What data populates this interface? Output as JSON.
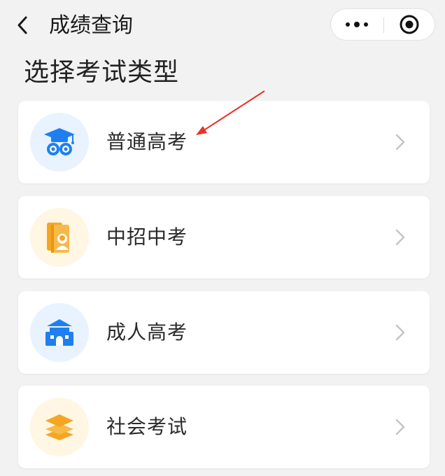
{
  "nav": {
    "back_icon": "chevron-left-icon",
    "title": "成绩查询",
    "more_icon": "ellipsis-icon",
    "close_icon": "target-circle-icon"
  },
  "heading": "选择考试类型",
  "cards": [
    {
      "label": "普通高考",
      "icon": "graduation-owl-icon",
      "icon_bg": "#e8f3ff",
      "icon_color": "#1f7ff0"
    },
    {
      "label": "中招中考",
      "icon": "book-student-icon",
      "icon_bg": "#fff6e3",
      "icon_color": "#f4a623"
    },
    {
      "label": "成人高考",
      "icon": "school-building-icon",
      "icon_bg": "#e8f3ff",
      "icon_color": "#1f7ff0"
    },
    {
      "label": "社会考试",
      "icon": "layers-stack-icon",
      "icon_bg": "#fff6e3",
      "icon_color": "#f4a623"
    }
  ],
  "annotation": {
    "arrow_color": "#e8332a"
  }
}
